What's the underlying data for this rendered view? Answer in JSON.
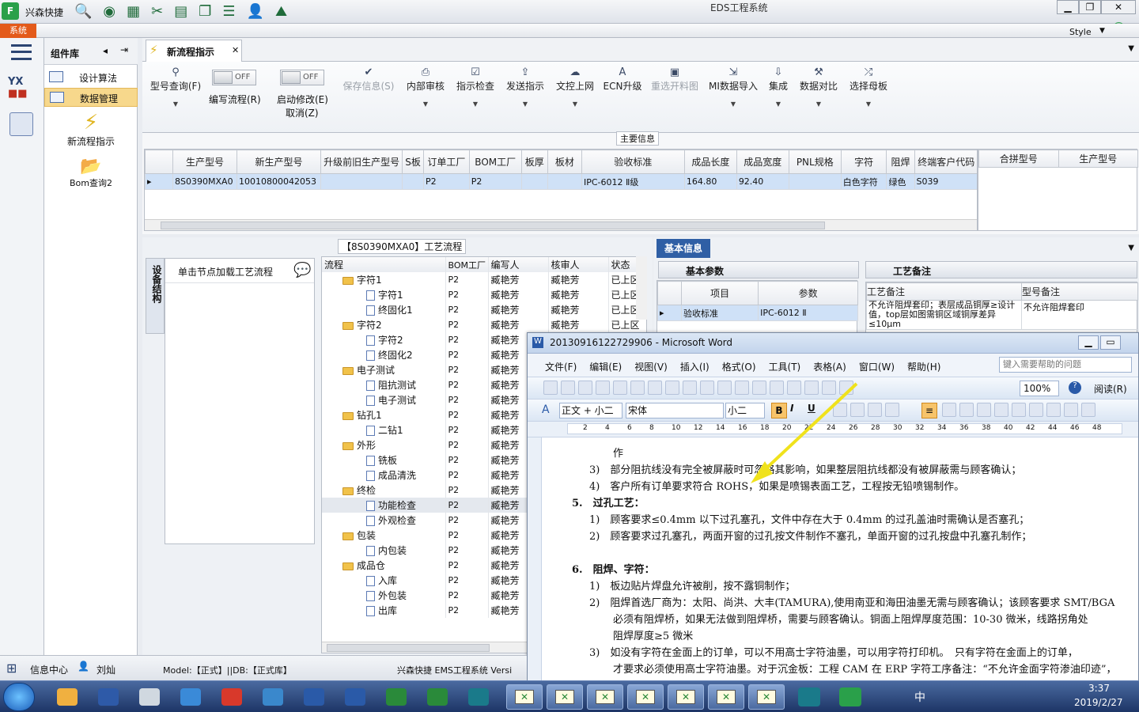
{
  "titlebar": {
    "app_name": "兴森快捷",
    "title": "EDS工程系统"
  },
  "system_tab": {
    "label": "系统",
    "style_label": "Style"
  },
  "component_panel": {
    "title": "组件库",
    "items": [
      {
        "label": "设计算法"
      },
      {
        "label": "数据管理"
      }
    ],
    "tools": [
      {
        "label": "新流程指示"
      },
      {
        "label": "Bom查询2"
      }
    ]
  },
  "doc_tab": {
    "label": "新流程指示"
  },
  "ribbon": {
    "model_query": "型号查询(F)",
    "edit_flow": "编写流程(R)",
    "start_modify": "启动修改(E)",
    "cancel": "取消(Z)",
    "toggle_off": "OFF",
    "buttons": [
      {
        "label": "保存信息(S)",
        "disabled": true
      },
      {
        "label": "内部审核"
      },
      {
        "label": "指示检查"
      },
      {
        "label": "发送指示"
      },
      {
        "label": "文控上网"
      },
      {
        "label": "ECN升级"
      },
      {
        "label": "重选开料图",
        "disabled": true
      },
      {
        "label": "MI数据导入"
      },
      {
        "label": "集成"
      },
      {
        "label": "数据对比"
      },
      {
        "label": "选择母板"
      }
    ]
  },
  "main_info": {
    "title": "主要信息",
    "columns": [
      "生产型号",
      "新生产型号",
      "升级前旧生产型号",
      "S板",
      "订单工厂",
      "BOM工厂",
      "板厚",
      "板材",
      "验收标准",
      "成品长度",
      "成品宽度",
      "PNL规格",
      "字符",
      "阻焊",
      "终端客户代码"
    ],
    "row": [
      "8S0390MXA0",
      "10010800042053",
      "",
      "",
      "P2",
      "P2",
      "",
      "",
      "IPC-6012 Ⅱ级",
      "164.80",
      "92.40",
      "",
      "白色字符",
      "绿色",
      "S039"
    ],
    "side_columns": [
      "合拼型号",
      "生产型号"
    ]
  },
  "process": {
    "title": "【8S0390MXA0】工艺流程",
    "side_tab": "设备结构",
    "load_hint": "单击节点加载工艺流程",
    "columns": [
      "流程",
      "BOM工厂",
      "编写人",
      "核审人",
      "状态"
    ],
    "rows": [
      {
        "name": "字符1",
        "lvl": 0,
        "f": "P2",
        "w": "臧艳芳",
        "c": "臧艳芳",
        "s": "已上区"
      },
      {
        "name": "字符1",
        "lvl": 1,
        "f": "P2",
        "w": "臧艳芳",
        "c": "臧艳芳",
        "s": "已上区"
      },
      {
        "name": "终固化1",
        "lvl": 1,
        "f": "P2",
        "w": "臧艳芳",
        "c": "臧艳芳",
        "s": "已上区"
      },
      {
        "name": "字符2",
        "lvl": 0,
        "f": "P2",
        "w": "臧艳芳",
        "c": "臧艳芳",
        "s": "已上区"
      },
      {
        "name": "字符2",
        "lvl": 1,
        "f": "P2",
        "w": "臧艳芳",
        "c": "臧艳芳",
        "s": "已上区"
      },
      {
        "name": "终固化2",
        "lvl": 1,
        "f": "P2",
        "w": "臧艳芳",
        "c": "臧艳芳",
        "s": ""
      },
      {
        "name": "电子测试",
        "lvl": 0,
        "f": "P2",
        "w": "臧艳芳",
        "c": "",
        "s": ""
      },
      {
        "name": "阻抗测试",
        "lvl": 1,
        "f": "P2",
        "w": "臧艳芳",
        "c": "",
        "s": ""
      },
      {
        "name": "电子测试",
        "lvl": 1,
        "f": "P2",
        "w": "臧艳芳",
        "c": "",
        "s": ""
      },
      {
        "name": "钻孔1",
        "lvl": 0,
        "f": "P2",
        "w": "臧艳芳",
        "c": "",
        "s": ""
      },
      {
        "name": "二钻1",
        "lvl": 1,
        "f": "P2",
        "w": "臧艳芳",
        "c": "",
        "s": ""
      },
      {
        "name": "外形",
        "lvl": 0,
        "f": "P2",
        "w": "臧艳芳",
        "c": "",
        "s": ""
      },
      {
        "name": "铣板",
        "lvl": 1,
        "f": "P2",
        "w": "臧艳芳",
        "c": "",
        "s": ""
      },
      {
        "name": "成品清洗",
        "lvl": 1,
        "f": "P2",
        "w": "臧艳芳",
        "c": "",
        "s": ""
      },
      {
        "name": "终检",
        "lvl": 0,
        "f": "P2",
        "w": "臧艳芳",
        "c": "",
        "s": ""
      },
      {
        "name": "功能检查",
        "lvl": 1,
        "f": "P2",
        "w": "臧艳芳",
        "c": "",
        "s": ""
      },
      {
        "name": "外观检查",
        "lvl": 1,
        "f": "P2",
        "w": "臧艳芳",
        "c": "",
        "s": ""
      },
      {
        "name": "包装",
        "lvl": 0,
        "f": "P2",
        "w": "臧艳芳",
        "c": "",
        "s": ""
      },
      {
        "name": "内包装",
        "lvl": 1,
        "f": "P2",
        "w": "臧艳芳",
        "c": "",
        "s": ""
      },
      {
        "name": "成品仓",
        "lvl": 0,
        "f": "P2",
        "w": "臧艳芳",
        "c": "",
        "s": ""
      },
      {
        "name": "入库",
        "lvl": 1,
        "f": "P2",
        "w": "臧艳芳",
        "c": "",
        "s": ""
      },
      {
        "name": "外包装",
        "lvl": 1,
        "f": "P2",
        "w": "臧艳芳",
        "c": "",
        "s": ""
      },
      {
        "name": "出库",
        "lvl": 1,
        "f": "P2",
        "w": "臧艳芳",
        "c": "",
        "s": ""
      }
    ]
  },
  "basic_info": {
    "title": "基本信息",
    "params_tab": "基本参数",
    "remarks_tab": "工艺备注",
    "param_cols": [
      "项目",
      "参数"
    ],
    "param_row": [
      "验收标准",
      "IPC-6012 Ⅱ"
    ],
    "remark_cols": [
      "工艺备注",
      "型号备注"
    ],
    "remark_text": "不允许阻焊套印；表层成品铜厚≥设计值，top层如图需铜区域铜厚差异≤10μm",
    "model_remark": "不允许阻焊套印"
  },
  "word": {
    "title": "20130916122729906 - Microsoft Word",
    "menu": [
      "文件(F)",
      "编辑(E)",
      "视图(V)",
      "插入(I)",
      "格式(O)",
      "工具(T)",
      "表格(A)",
      "窗口(W)",
      "帮助(H)"
    ],
    "help_placeholder": "键入需要帮助的问题",
    "zoom": "100%",
    "read_btn": "阅读(R)",
    "style_box": "正文 + 小二",
    "font_box": "宋体",
    "size_box": "小二",
    "ruler": [
      "2",
      "4",
      "6",
      "8",
      "10",
      "12",
      "14",
      "16",
      "18",
      "20",
      "22",
      "24",
      "26",
      "28",
      "30",
      "32",
      "34",
      "36",
      "38",
      "40",
      "42",
      "44",
      "46",
      "48"
    ],
    "lines": [
      {
        "t": "作",
        "cls": "ind2"
      },
      {
        "t": "3)　部分阻抗线没有完全被屏蔽时可忽略其影响，如果整层阻抗线都没有被屏蔽需与顾客确认；",
        "cls": "ind1"
      },
      {
        "t": "4)　客户所有订单要求符合 ROHS，如果是喷锡表面工艺，工程按无铅喷锡制作。",
        "cls": "ind1"
      },
      {
        "t": "5.　过孔工艺：",
        "cls": "h"
      },
      {
        "t": "1)　顾客要求≤0.4mm 以下过孔塞孔，文件中存在大于 0.4mm 的过孔盖油时需确认是否塞孔；",
        "cls": "ind1"
      },
      {
        "t": "2)　顾客要求过孔塞孔，两面开窗的过孔按文件制作不塞孔，单面开窗的过孔按盘中孔塞孔制作；",
        "cls": "ind1"
      },
      {
        "t": "",
        "cls": "ind1"
      },
      {
        "t": "6.　阻焊、字符：",
        "cls": "h"
      },
      {
        "t": "1)　板边贴片焊盘允许被削，按不露铜制作；",
        "cls": "ind1"
      },
      {
        "t": "2)　阻焊首选厂商为：太阳、尚洪、大丰(TAMURA),使用南亚和海田油墨无需与顾客确认；该顾客要求 SMT/BGA",
        "cls": "ind1"
      },
      {
        "t": "必须有阻焊桥，如果无法做到阻焊桥，需要与顾客确认。铜面上阻焊厚度范围：10-30 微米，线路拐角处",
        "cls": "ind2"
      },
      {
        "t": "阻焊厚度≥5 微米",
        "cls": "ind2"
      },
      {
        "t": "3)　如没有字符在金面上的订单，可以不用高士字符油墨，可以用字符打印机。　只有字符在金面上的订单，",
        "cls": "ind1"
      },
      {
        "t": "才要求必须使用高士字符油墨。对于沉金板：工程 CAM 在 ERP 字符工序备注：“不允许金面字符渗油印迹”，",
        "cls": "ind2"
      }
    ]
  },
  "status": {
    "info_center": "信息中心",
    "user": "刘灿",
    "model": "Model:【正式】||DB:【正式库】",
    "brand": "兴森快捷 EMS工程系统 Versi"
  },
  "tray": {
    "ime": "中",
    "time": "3:37",
    "date": "2019/2/27"
  }
}
